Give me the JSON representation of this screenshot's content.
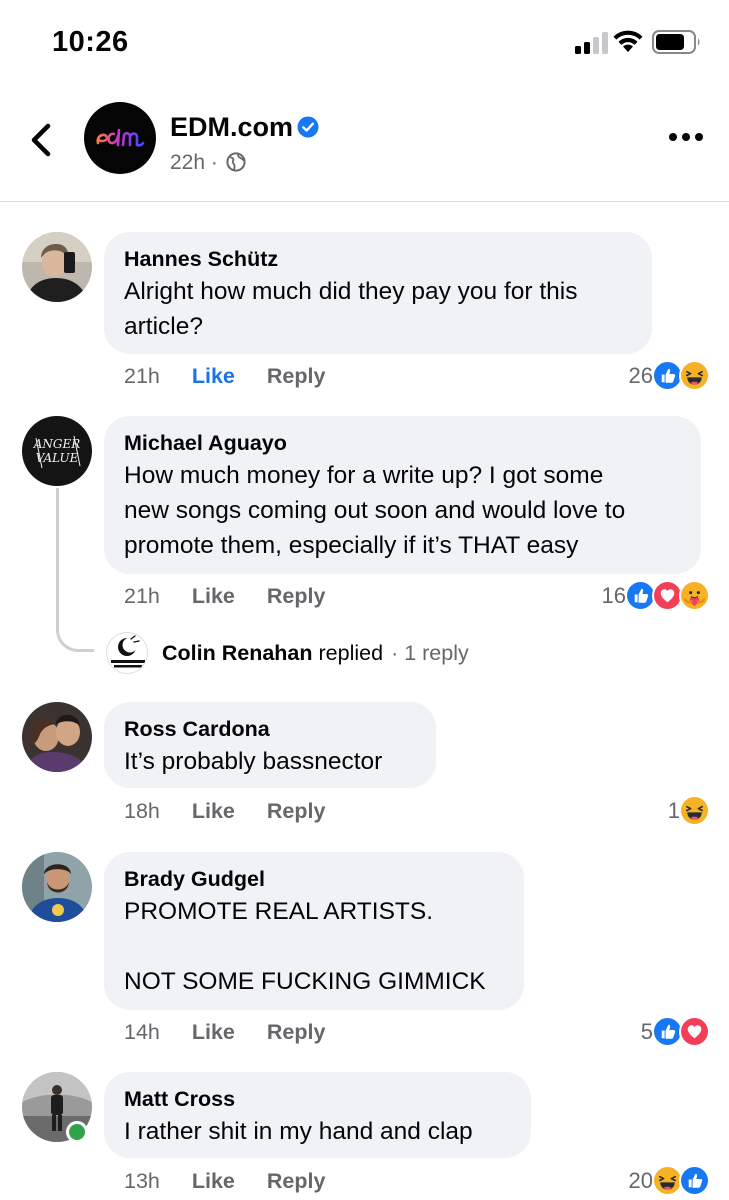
{
  "status_bar": {
    "time": "10:26"
  },
  "post_header": {
    "page_name": "EDM.com",
    "time": "22h",
    "separator": "·"
  },
  "comments": [
    {
      "author": "Hannes Schütz",
      "text": "Alright how much did they pay you for this\narticle?",
      "time": "21h",
      "like_label": "Like",
      "like_active": true,
      "reply_label": "Reply",
      "reaction_count": "26",
      "reactions": [
        "like",
        "haha"
      ]
    },
    {
      "author": "Michael Aguayo",
      "text": "How much money for a write up? I got some\nnew songs coming out soon and would love to\npromote them, especially if it’s THAT easy",
      "time": "21h",
      "like_label": "Like",
      "reply_label": "Reply",
      "reaction_count": "16",
      "reactions": [
        "like",
        "love",
        "care"
      ],
      "reply_preview": {
        "name": "Colin Renahan",
        "verb": "replied",
        "count": "· 1 reply"
      }
    },
    {
      "author": "Ross Cardona",
      "text": "It’s probably bassnector",
      "time": "18h",
      "like_label": "Like",
      "reply_label": "Reply",
      "reaction_count": "1",
      "reactions": [
        "haha"
      ]
    },
    {
      "author": "Brady Gudgel",
      "text": "PROMOTE REAL ARTISTS.\n\nNOT SOME FUCKING GIMMICK",
      "time": "14h",
      "like_label": "Like",
      "reply_label": "Reply",
      "reaction_count": "5",
      "reactions": [
        "like",
        "love"
      ]
    },
    {
      "author": "Matt Cross",
      "text": "I rather shit in my hand and clap",
      "time": "13h",
      "like_label": "Like",
      "reply_label": "Reply",
      "reaction_count": "20",
      "reactions": [
        "haha",
        "like"
      ],
      "online": true
    }
  ],
  "colors": {
    "like_blue": "#1b74e4",
    "bubble_bg": "#f0f2f5",
    "secondary_text": "#65676b",
    "verified_blue": "#1877f2",
    "online_green": "#31a24c"
  },
  "icons": [
    "back-arrow-icon",
    "verified-badge-icon",
    "globe-icon",
    "more-options-icon",
    "like-reaction-icon",
    "haha-reaction-icon",
    "love-reaction-icon",
    "care-reaction-icon"
  ]
}
